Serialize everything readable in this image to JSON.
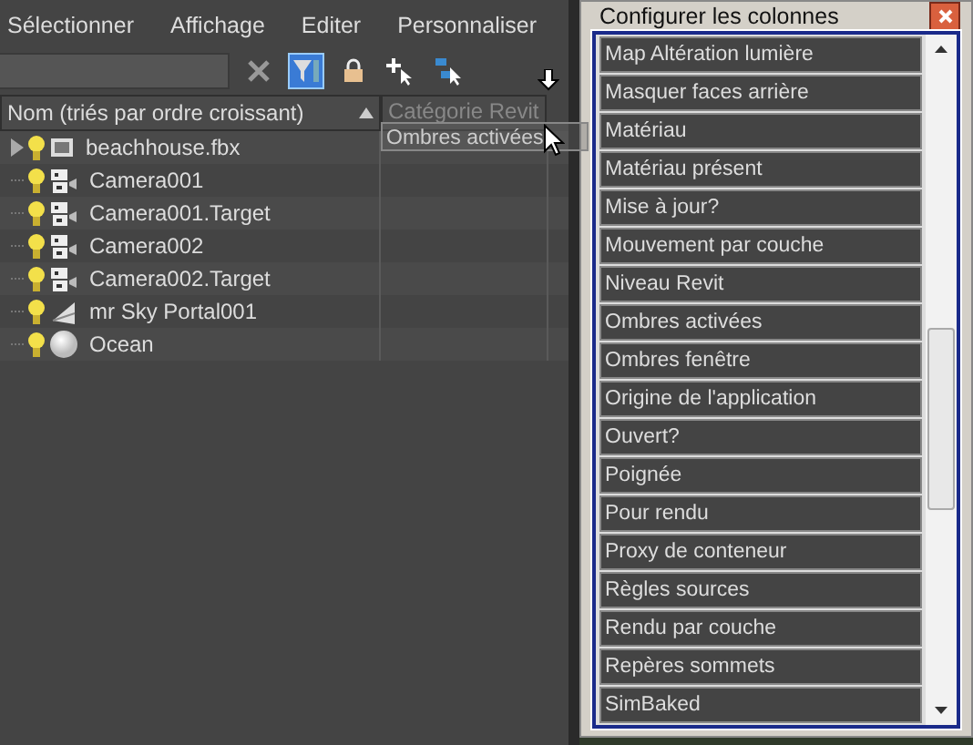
{
  "menu": [
    "Sélectionner",
    "Affichage",
    "Editer",
    "Personnaliser"
  ],
  "toolbar": {
    "filter_selected": true
  },
  "columns": [
    {
      "label": "Nom (triés par ordre croissant)",
      "sort_ascending": true
    },
    {
      "label": "Catégorie Revit"
    }
  ],
  "drag_ghost": {
    "label": "Ombres activées"
  },
  "rows": [
    {
      "name": "beachhouse.fbx",
      "kind": "file",
      "expandable": true
    },
    {
      "name": "Camera001",
      "kind": "camera",
      "expandable": false
    },
    {
      "name": "Camera001.Target",
      "kind": "camera",
      "expandable": false
    },
    {
      "name": "Camera002",
      "kind": "camera",
      "expandable": false
    },
    {
      "name": "Camera002.Target",
      "kind": "camera",
      "expandable": false
    },
    {
      "name": "mr Sky Portal001",
      "kind": "portal",
      "expandable": false
    },
    {
      "name": "Ocean",
      "kind": "sphere",
      "expandable": false
    }
  ],
  "dialog": {
    "title": "Configurer les colonnes",
    "items": [
      "Map Altération lumière",
      "Masquer faces arrière",
      "Matériau",
      "Matériau présent",
      "Mise à jour?",
      "Mouvement par couche",
      "Niveau Revit",
      "Ombres activées",
      "Ombres fenêtre",
      "Origine de l'application",
      "Ouvert?",
      "Poignée",
      "Pour rendu",
      "Proxy de conteneur",
      "Règles sources",
      "Rendu par couche",
      "Repères sommets",
      "SimBaked"
    ]
  }
}
